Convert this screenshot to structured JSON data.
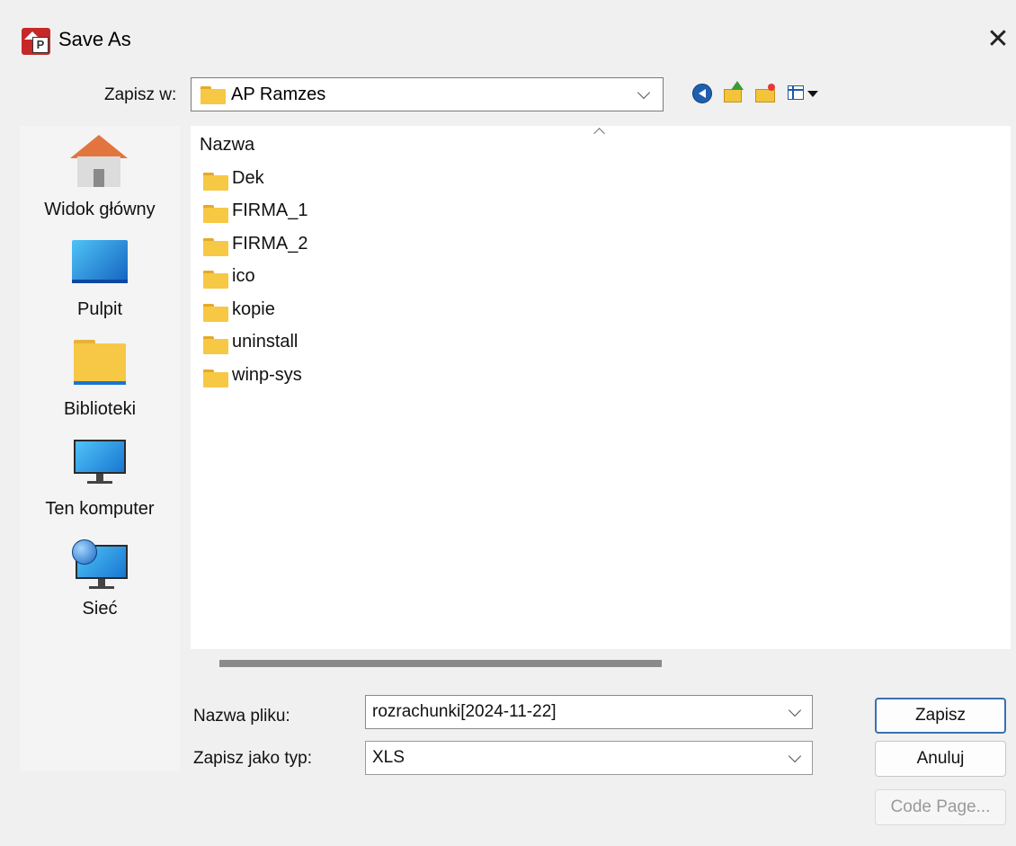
{
  "window": {
    "title": "Save As",
    "app_icon": "app-logo-icon",
    "close_glyph": "✕"
  },
  "lookin": {
    "label": "Zapisz w:",
    "value": "AP Ramzes",
    "icon": "folder-icon"
  },
  "toolbar": {
    "back": "back-icon",
    "up": "up-folder-icon",
    "new_folder": "new-folder-icon",
    "view_menu": "view-menu-icon"
  },
  "places": [
    {
      "label": "Widok główny",
      "icon": "home-icon"
    },
    {
      "label": "Pulpit",
      "icon": "desktop-icon"
    },
    {
      "label": "Biblioteki",
      "icon": "libraries-icon"
    },
    {
      "label": "Ten komputer",
      "icon": "computer-icon"
    },
    {
      "label": "Sieć",
      "icon": "network-icon"
    }
  ],
  "filelist": {
    "column": "Nazwa",
    "items": [
      "Dek",
      "FIRMA_1",
      "FIRMA_2",
      "ico",
      "kopie",
      "uninstall",
      "winp-sys"
    ]
  },
  "filename": {
    "label": "Nazwa pliku:",
    "value": "rozrachunki[2024-11-22]"
  },
  "filetype": {
    "label": "Zapisz jako typ:",
    "value": "XLS"
  },
  "buttons": {
    "save": "Zapisz",
    "cancel": "Anuluj",
    "code_page": "Code Page..."
  },
  "colors": {
    "accent": "#3b6fb5",
    "folder": "#f7c843",
    "home_roof": "#e2753d"
  }
}
